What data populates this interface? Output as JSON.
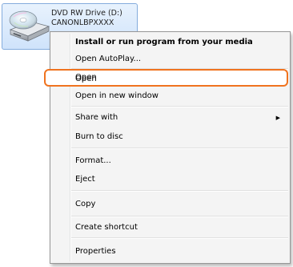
{
  "drive": {
    "name": "DVD RW Drive (D:)",
    "label": "CANONLBPXXXX",
    "icon": "dvd-drive-icon"
  },
  "context_menu": {
    "items": [
      {
        "label": "Install or run program from your media",
        "bold": true
      },
      {
        "label": "Open AutoPlay..."
      },
      {
        "label": "Open",
        "highlighted": true
      },
      {
        "label": "Open in new window"
      },
      {
        "label": "Share with",
        "has_submenu": true
      },
      {
        "label": "Burn to disc"
      },
      {
        "label": "Format..."
      },
      {
        "label": "Eject"
      },
      {
        "label": "Copy"
      },
      {
        "label": "Create shortcut"
      },
      {
        "label": "Properties"
      }
    ]
  },
  "colors": {
    "highlight_outline": "#f0731f",
    "selection_border": "#84acdd",
    "selection_fill": "#cfe3fb",
    "menu_background": "#f4f4f4"
  }
}
